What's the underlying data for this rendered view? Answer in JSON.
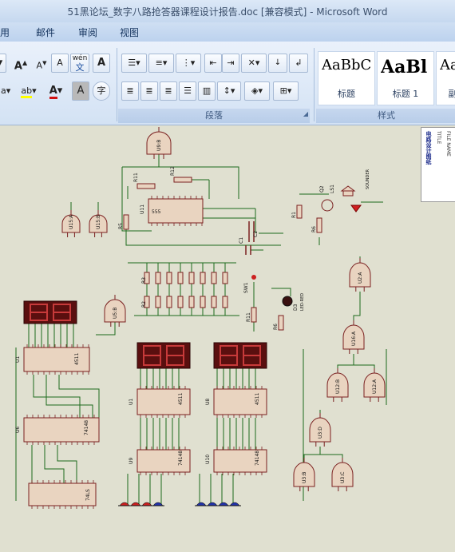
{
  "window": {
    "title": "51黑论坛_数字八路抢答器课程设计报告.doc [兼容模式] - Microsoft Word"
  },
  "tabs": [
    "用",
    "邮件",
    "审阅",
    "视图"
  ],
  "ribbon": {
    "groups": {
      "paragraph": "段落",
      "styles": "样式"
    },
    "font_buttons": {
      "grow": "A",
      "shrink": "A",
      "clear": "A",
      "phonetic": "wén",
      "border_char": "A",
      "highlight": "ab",
      "font_color": "A",
      "shade_char": "A",
      "enclose": "字"
    },
    "styles": [
      {
        "sample": "AaBbC",
        "name": "标题"
      },
      {
        "sample": "AaBl",
        "name": "标题 1"
      },
      {
        "sample": "Aa",
        "name": "副"
      }
    ]
  },
  "colors": {
    "wire": "#1c6a1c",
    "part": "#7a2020",
    "part_fill": "#e9d4c0",
    "display_bg": "#5a0f0f",
    "display_seg": "#c73a3a",
    "button_red": "#cc2020",
    "button_blue": "#2233aa"
  },
  "schematic_labels": {
    "u1": "U1",
    "u2a": "U2:A",
    "u6": "U6",
    "u8": "U8",
    "u9": "U9",
    "u10": "U10",
    "r1": "R1",
    "r2": "R2",
    "r3": "R3",
    "r5": "R5",
    "r6": "R6",
    "r11": "R11",
    "r12": "R12",
    "c1": "C1",
    "c2": "C2",
    "d3": "D3",
    "d3_type": "LED-RED",
    "q2": "Q2",
    "ls1": "LS1",
    "sounder": "SOUNDER",
    "sw1": "SW1",
    "u12a": "U12:A",
    "u12b": "U12:B",
    "u16a": "U16:A",
    "u15a": "U15:A",
    "u15b": "U15:B",
    "u3b": "U3:B",
    "u3c": "U3:C",
    "u3d": "U3:D",
    "u5b": "U5:B",
    "u11": "U11",
    "ic_4511": "4511",
    "ic_74148": "74148",
    "ic_74ls": "74LS",
    "ic_555": "555"
  },
  "sidebar_doc": {
    "text1": "电路设计图纸",
    "text2": "TITLE",
    "text3": "FILE NAME"
  }
}
